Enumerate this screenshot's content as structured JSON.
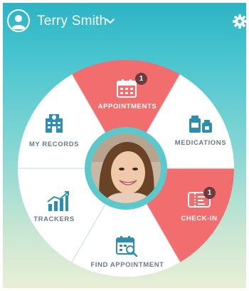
{
  "header": {
    "user_name": "Terry Smith",
    "account_icon": "user-circle-icon",
    "settings_icon": "gear-icon"
  },
  "menu": {
    "appointments": {
      "label": "APPOINTMENTS",
      "icon": "calendar-icon",
      "badge": "1",
      "highlight": true
    },
    "medications": {
      "label": "MEDICATIONS",
      "icon": "pharmacy-icon",
      "highlight": false
    },
    "check_in": {
      "label": "CHECK-IN",
      "icon": "ticket-icon",
      "badge": "1",
      "highlight": true
    },
    "find_appointment": {
      "label": "FIND APPOINTMENT",
      "icon": "calendar-search-icon",
      "highlight": false
    },
    "trackers": {
      "label": "TRACKERS",
      "icon": "chart-icon",
      "highlight": false
    },
    "my_records": {
      "label": "MY RECORDS",
      "icon": "hospital-icon",
      "highlight": false
    }
  },
  "colors": {
    "accent_red": "#f26d6d",
    "teal": "#5bc8cc",
    "icon_blue": "#2d8fb0",
    "label_gray": "#6a7a88",
    "badge": "#6b3b3f"
  }
}
